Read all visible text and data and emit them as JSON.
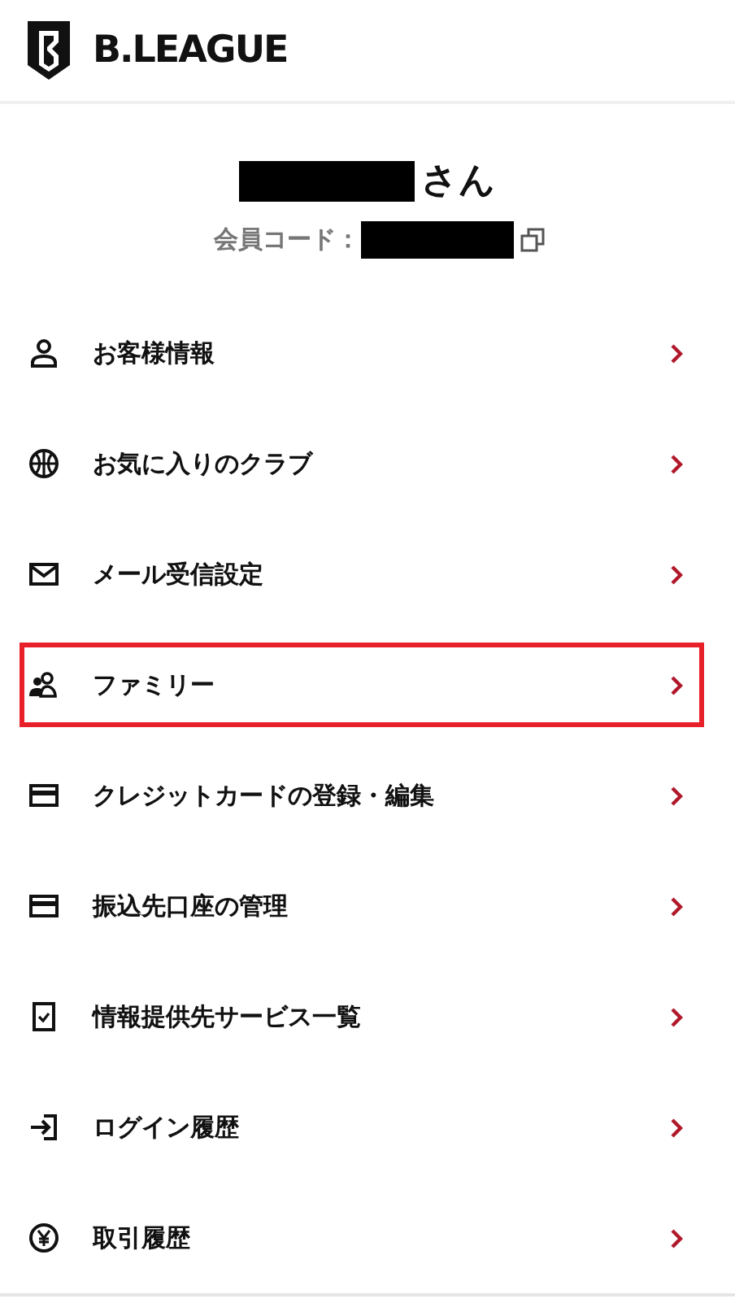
{
  "header": {
    "brand": "B.LEAGUE"
  },
  "profile": {
    "name_suffix": "さん",
    "member_code_label": "会員コード："
  },
  "menu": [
    {
      "label": "お客様情報",
      "highlighted": false
    },
    {
      "label": "お気に入りのクラブ",
      "highlighted": false
    },
    {
      "label": "メール受信設定",
      "highlighted": false
    },
    {
      "label": "ファミリー",
      "highlighted": true
    },
    {
      "label": "クレジットカードの登録・編集",
      "highlighted": false
    },
    {
      "label": "振込先口座の管理",
      "highlighted": false
    },
    {
      "label": "情報提供先サービス一覧",
      "highlighted": false
    },
    {
      "label": "ログイン履歴",
      "highlighted": false
    },
    {
      "label": "取引履歴",
      "highlighted": false
    }
  ]
}
